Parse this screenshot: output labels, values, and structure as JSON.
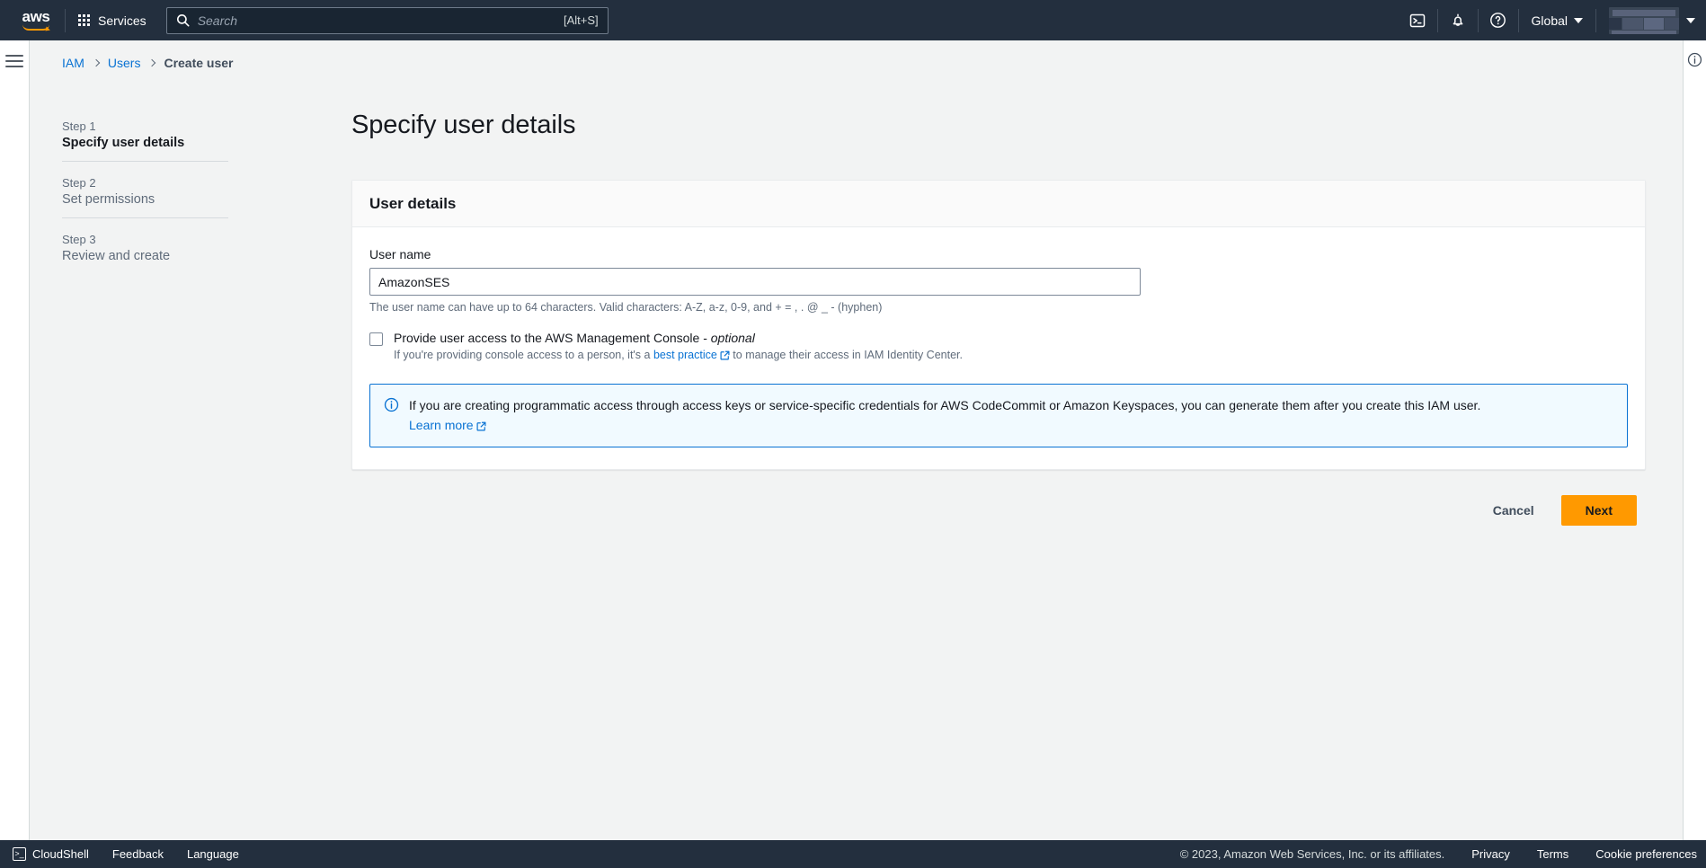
{
  "topnav": {
    "logo_wordmark": "aws",
    "services_label": "Services",
    "search": {
      "placeholder": "Search",
      "shortcut": "[Alt+S]"
    },
    "cloudshell_icon": "cloudshell-icon",
    "notifications_icon": "bell-icon",
    "help_icon": "question-circle-icon",
    "region_label": "Global",
    "account_label": ""
  },
  "breadcrumb": {
    "items": [
      {
        "label": "IAM",
        "link": true
      },
      {
        "label": "Users",
        "link": true
      },
      {
        "label": "Create user",
        "link": false
      }
    ]
  },
  "wizard": {
    "steps": [
      {
        "num": "Step 1",
        "label": "Specify user details",
        "active": true
      },
      {
        "num": "Step 2",
        "label": "Set permissions",
        "active": false
      },
      {
        "num": "Step 3",
        "label": "Review and create",
        "active": false
      }
    ]
  },
  "main": {
    "title": "Specify user details",
    "card": {
      "heading": "User details",
      "username_label": "User name",
      "username_value": "AmazonSES",
      "username_placeholder": "",
      "username_hint": "The user name can have up to 64 characters. Valid characters: A-Z, a-z, 0-9, and + = , . @ _ - (hyphen)",
      "console_access": {
        "checked": false,
        "label_main": "Provide user access to the AWS Management Console - ",
        "label_optional": "optional",
        "sub_prefix": "If you're providing console access to a person, it's a ",
        "sub_link": "best practice",
        "sub_suffix": " to manage their access in IAM Identity Center."
      },
      "alert": {
        "icon": "info-circle-icon",
        "text": "If you are creating programmatic access through access keys or service-specific credentials for AWS CodeCommit or Amazon Keyspaces, you can generate them after you create this IAM user.",
        "link": "Learn more"
      }
    },
    "cancel_label": "Cancel",
    "next_label": "Next"
  },
  "right_rail": {
    "info_icon": "info-circle-icon"
  },
  "footer": {
    "cloudshell_label": "CloudShell",
    "feedback_label": "Feedback",
    "language_label": "Language",
    "copyright": "© 2023, Amazon Web Services, Inc. or its affiliates.",
    "privacy_label": "Privacy",
    "terms_label": "Terms",
    "cookie_label": "Cookie preferences"
  },
  "colors": {
    "nav_bg": "#232f3e",
    "page_bg": "#f2f3f3",
    "link": "#0972d3",
    "accent": "#ff9900",
    "alert_bg": "#f1faff"
  }
}
